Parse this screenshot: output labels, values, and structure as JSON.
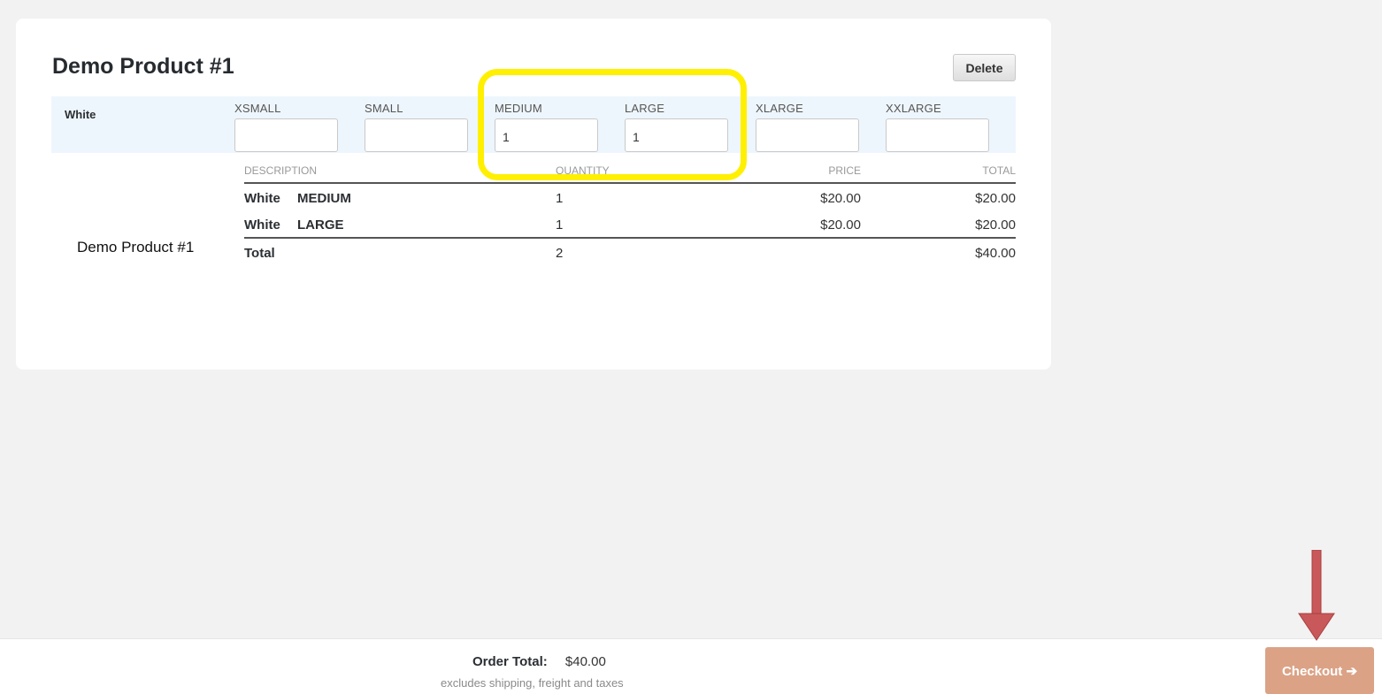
{
  "product": {
    "title": "Demo Product #1",
    "delete_label": "Delete",
    "color": "White",
    "sizes": [
      {
        "label": "XSMALL",
        "value": ""
      },
      {
        "label": "SMALL",
        "value": ""
      },
      {
        "label": "MEDIUM",
        "value": "1"
      },
      {
        "label": "LARGE",
        "value": "1"
      },
      {
        "label": "XLARGE",
        "value": ""
      },
      {
        "label": "XXLARGE",
        "value": ""
      }
    ]
  },
  "summary": {
    "name": "Demo Product #1",
    "headers": {
      "description": "DESCRIPTION",
      "quantity": "QUANTITY",
      "price": "PRICE",
      "total": "TOTAL"
    },
    "rows": [
      {
        "color": "White",
        "size": "MEDIUM",
        "quantity": "1",
        "price": "$20.00",
        "total": "$20.00"
      },
      {
        "color": "White",
        "size": "LARGE",
        "quantity": "1",
        "price": "$20.00",
        "total": "$20.00"
      }
    ],
    "total": {
      "label": "Total",
      "quantity": "2",
      "amount": "$40.00"
    }
  },
  "footer": {
    "order_total_label": "Order Total:",
    "order_total_value": "$40.00",
    "note": "excludes shipping, freight and taxes",
    "checkout_label": "Checkout ➔"
  },
  "colors": {
    "highlight": "#ffef00",
    "arrow": "#c9585a",
    "checkout": "#dba286",
    "variant_row": "#eef6fd"
  }
}
